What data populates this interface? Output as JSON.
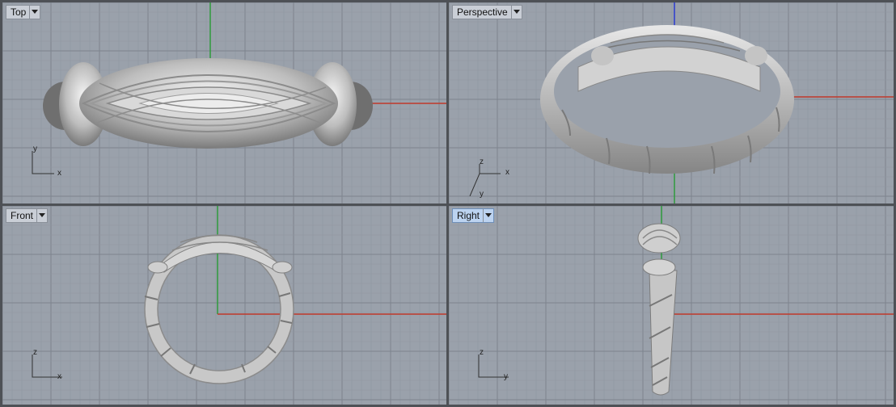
{
  "viewports": [
    {
      "id": "top",
      "title": "Top",
      "axis_labels": [
        "y",
        "x"
      ]
    },
    {
      "id": "perspective",
      "title": "Perspective",
      "axis_labels": [
        "z",
        "x",
        "y"
      ]
    },
    {
      "id": "front",
      "title": "Front",
      "axis_labels": [
        "z",
        "x"
      ]
    },
    {
      "id": "right",
      "title": "Right",
      "axis_labels": [
        "z",
        "y"
      ]
    }
  ],
  "active_viewport": "right",
  "colors": {
    "viewport_bg": "#9aa1ab",
    "grid_minor": "#8f96a0",
    "grid_major": "#7d848e",
    "x_axis": "#c0392b",
    "y_axis": "#2e9b3c",
    "z_axis": "#2b3bd0",
    "tab_active": "#bcd3f0"
  },
  "icons": {
    "dropdown": "chevron-down-icon"
  }
}
